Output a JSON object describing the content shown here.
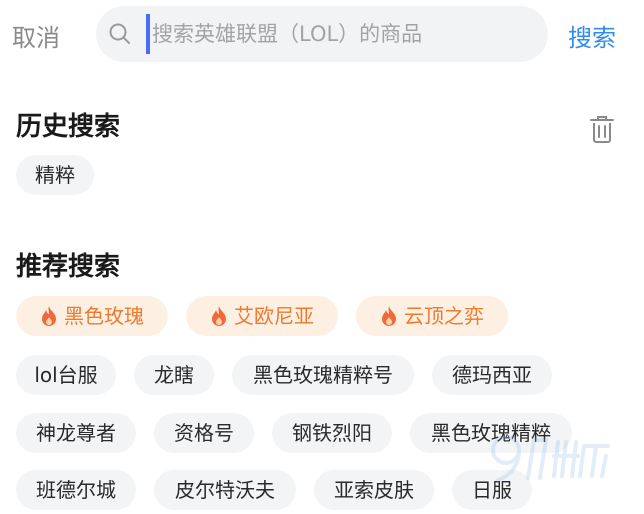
{
  "header": {
    "cancel_label": "取消",
    "search_placeholder": "搜索英雄联盟（LOL）的商品",
    "search_label": "搜索"
  },
  "history": {
    "title": "历史搜索",
    "items": [
      "精粹"
    ]
  },
  "recommended": {
    "title": "推荐搜索",
    "hot_items": [
      "黑色玫瑰",
      "艾欧尼亚",
      "云顶之弈"
    ],
    "items": [
      "lol台服",
      "龙瞎",
      "黑色玫瑰精粹号",
      "德玛西亚",
      "神龙尊者",
      "资格号",
      "钢铁烈阳",
      "黑色玫瑰精粹",
      "班德尔城",
      "皮尔特沃夫",
      "亚索皮肤",
      "日服"
    ]
  },
  "icons": {
    "search": "search-icon",
    "trash": "trash-icon",
    "hot": "flame-icon"
  },
  "colors": {
    "accent": "#2f8df0",
    "hot_text": "#ee7a2e",
    "hot_bg": "#fdf0e3",
    "chip_bg": "#f3f4f6"
  }
}
